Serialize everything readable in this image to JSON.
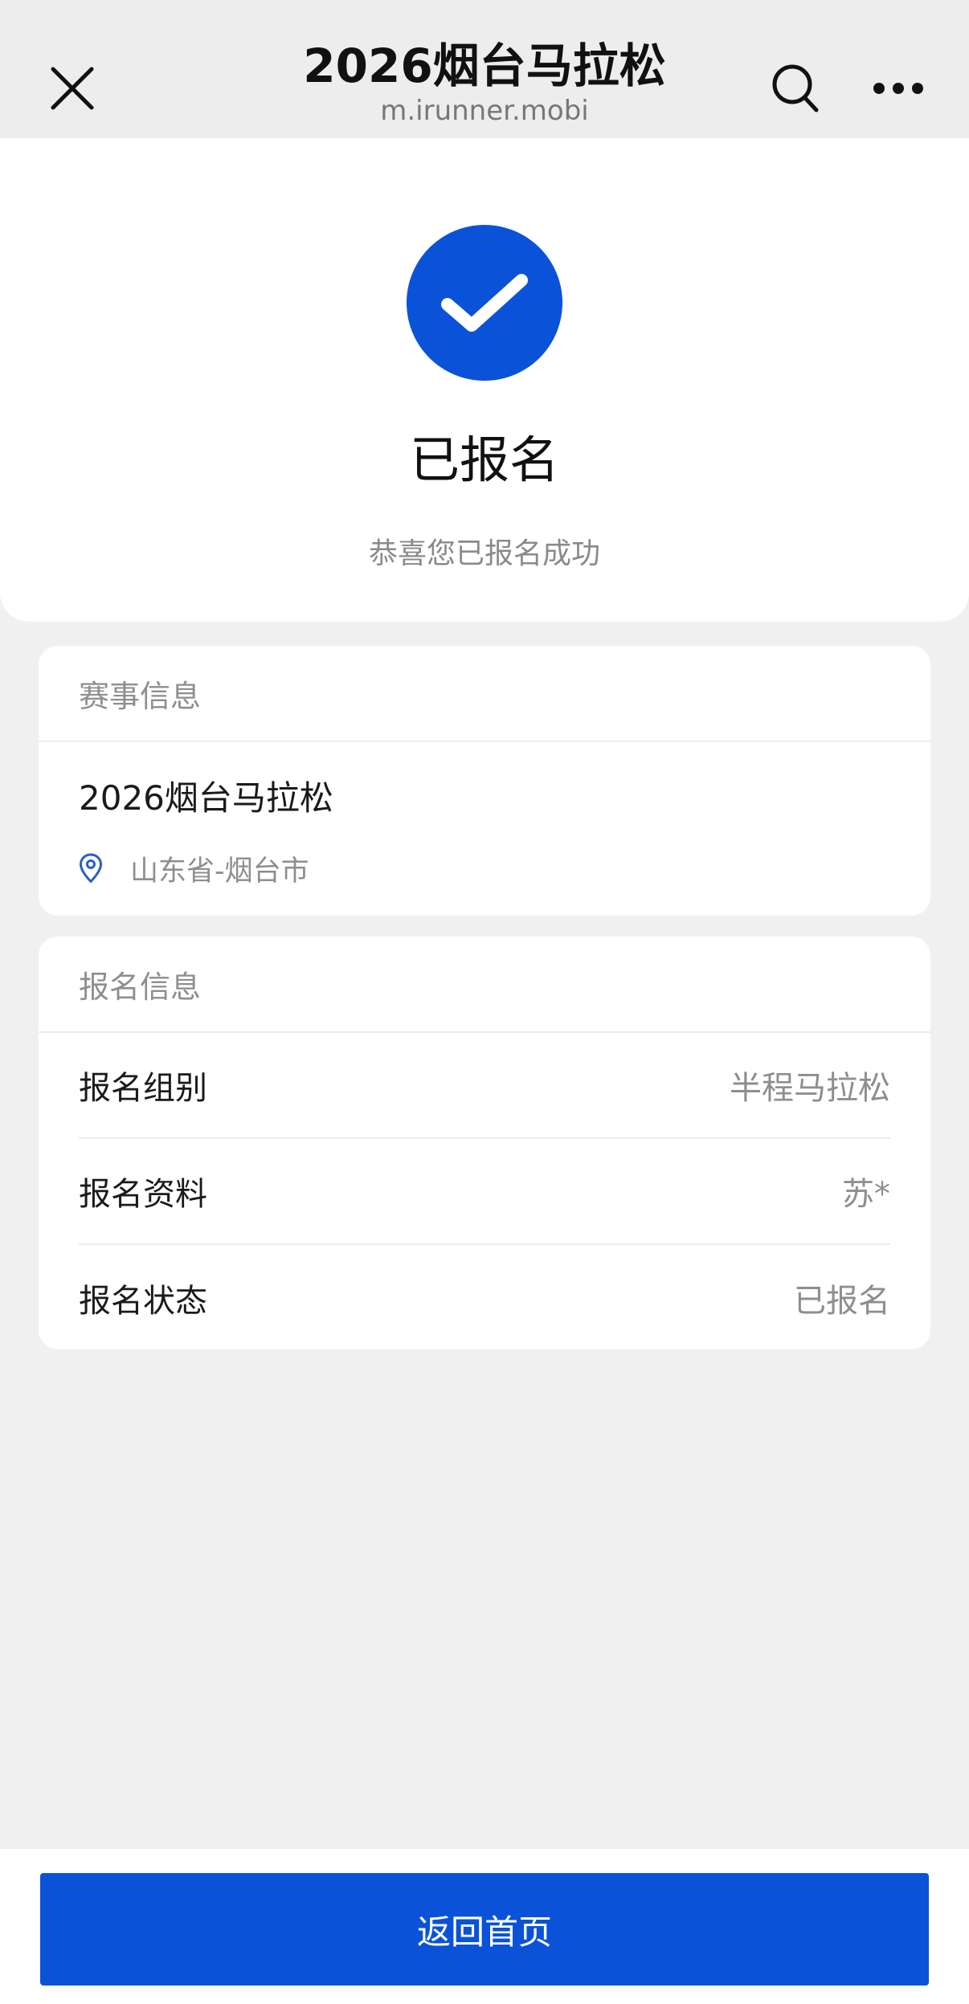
{
  "nav": {
    "title": "2026烟台马拉松",
    "subtitle": "m.irunner.mobi",
    "icons": {
      "close": "close-icon",
      "search": "search-icon",
      "more": "more-icon"
    }
  },
  "hero": {
    "status_icon": "check-icon",
    "title": "已报名",
    "subtitle": "恭喜您已报名成功"
  },
  "event_card": {
    "header": "赛事信息",
    "name": "2026烟台马拉松",
    "location": "山东省-烟台市",
    "location_icon": "location-pin-icon"
  },
  "registration_card": {
    "header": "报名信息",
    "rows": [
      {
        "label": "报名组别",
        "value": "半程马拉松"
      },
      {
        "label": "报名资料",
        "value": "苏*"
      },
      {
        "label": "报名状态",
        "value": "已报名"
      }
    ]
  },
  "footer": {
    "home_button": "返回首页"
  },
  "colors": {
    "accent": "#0a52d8",
    "background": "#f0f0f0",
    "muted_text": "#8e8e8e"
  }
}
